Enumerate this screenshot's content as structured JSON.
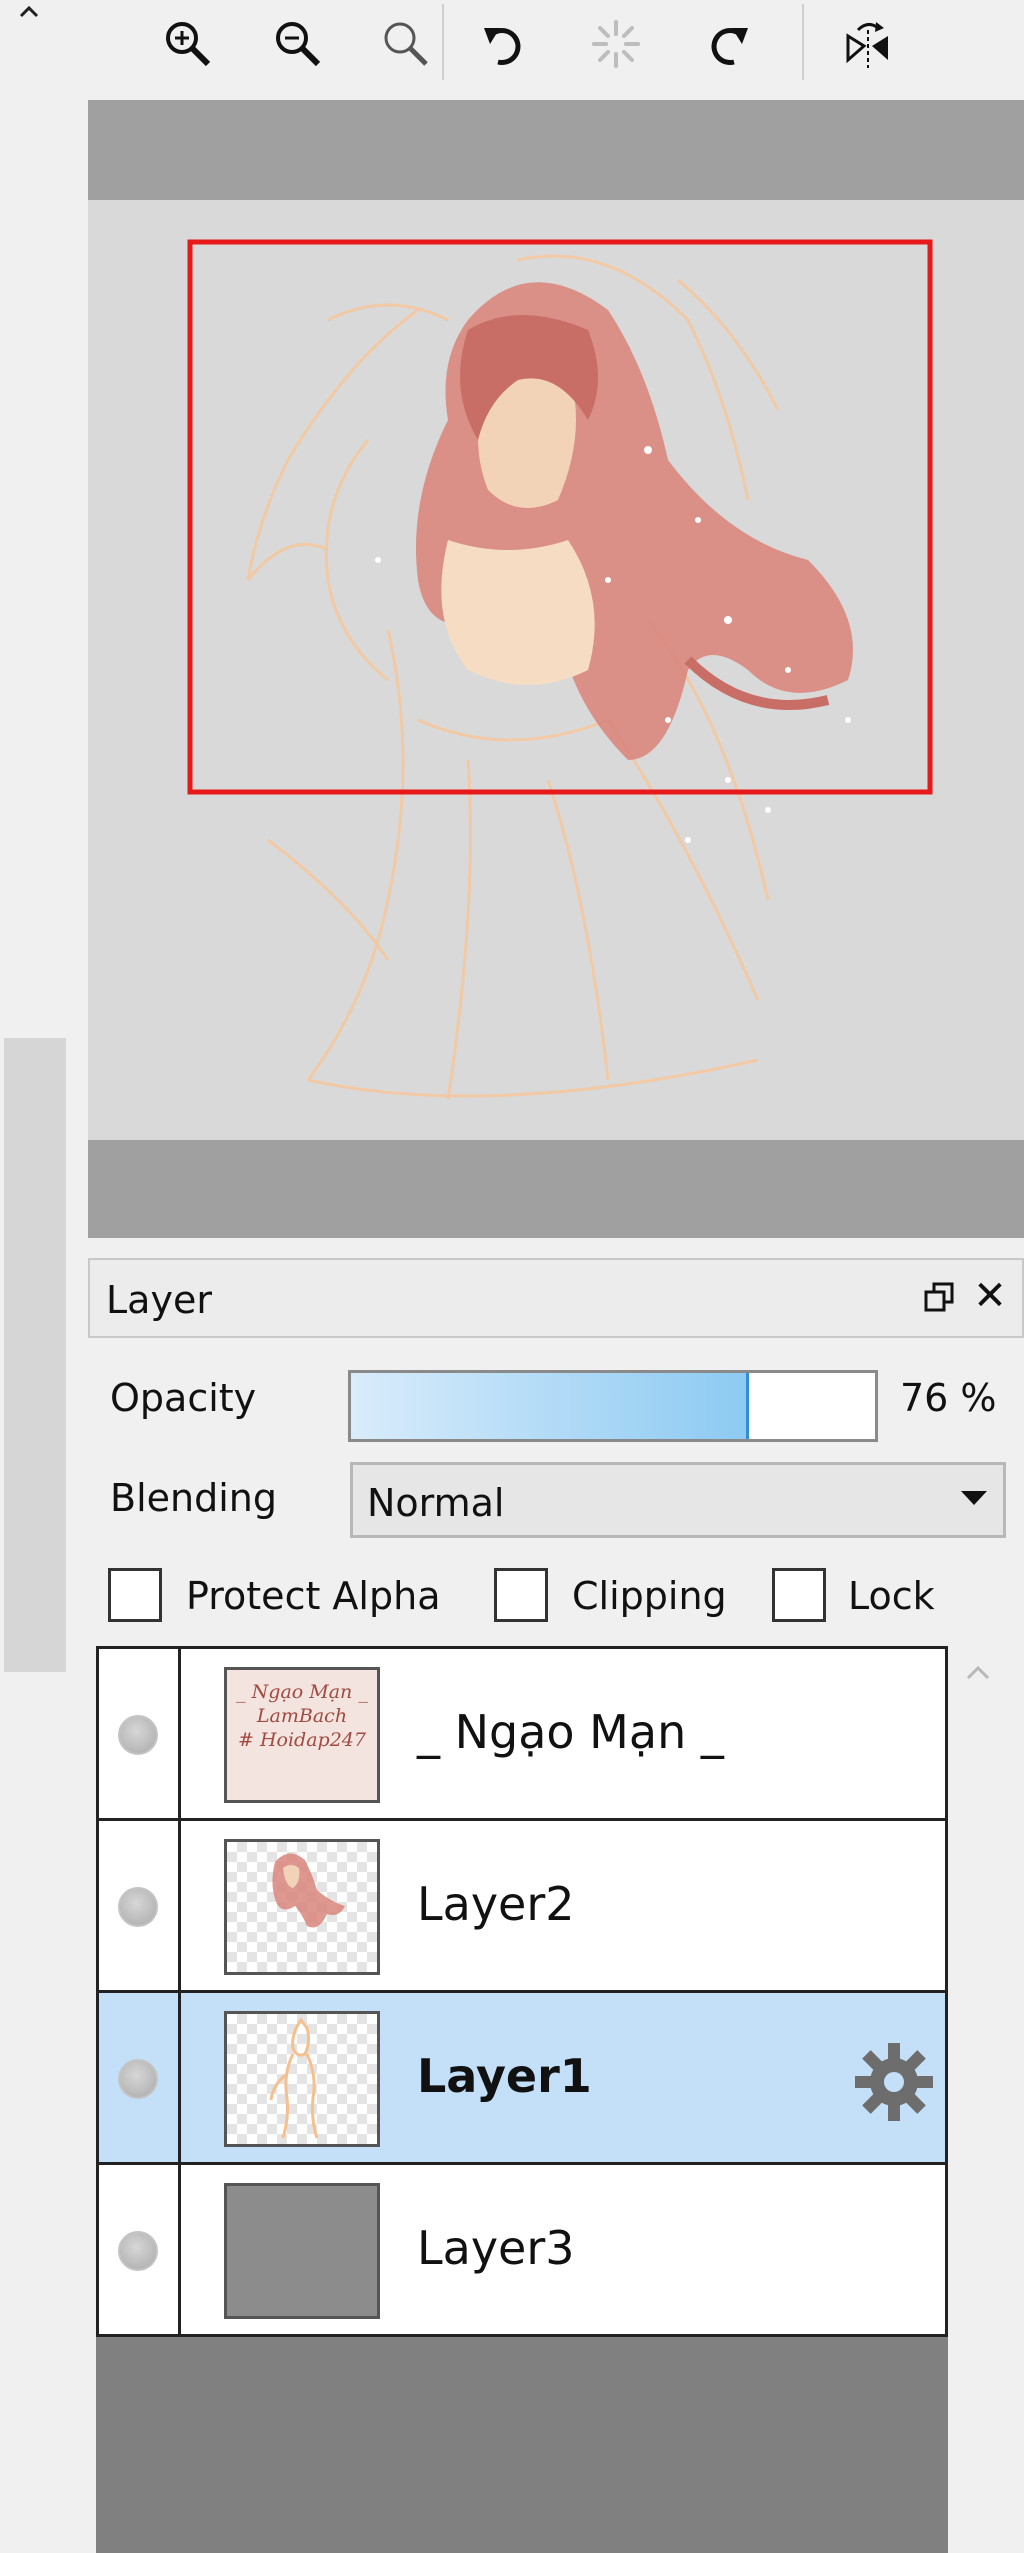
{
  "toolbar": {
    "buttons": [
      {
        "name": "zoom-in-icon",
        "label": "Zoom In"
      },
      {
        "name": "zoom-out-icon",
        "label": "Zoom Out"
      },
      {
        "name": "zoom-reset-icon",
        "label": "Actual Size"
      },
      {
        "name": "rotate-left-icon",
        "label": "Rotate Left"
      },
      {
        "name": "rotate-reset-icon",
        "label": "Reset Rotation"
      },
      {
        "name": "rotate-right-icon",
        "label": "Rotate Right"
      },
      {
        "name": "flip-horizontal-icon",
        "label": "Flip Horizontal"
      }
    ]
  },
  "navigator": {
    "viewport_color": "#e8191a"
  },
  "layer_panel": {
    "title": "Layer",
    "opacity_label": "Opacity",
    "opacity_value": "76 %",
    "opacity_level": 0.76,
    "blending_label": "Blending",
    "blending_value": "Normal",
    "protect_alpha_label": "Protect Alpha",
    "clipping_label": "Clipping",
    "lock_label": "Lock",
    "protect_alpha_checked": false,
    "clipping_checked": false,
    "lock_checked": false,
    "layers": [
      {
        "name": "_ Ngạo Mạn _",
        "thumb": "text",
        "thumb_text": [
          "_ Ngạo Mạn _",
          "LamBach",
          "# Hoidap247"
        ],
        "selected": false
      },
      {
        "name": "Layer2",
        "thumb": "painting",
        "selected": false
      },
      {
        "name": "Layer1",
        "thumb": "sketch",
        "selected": true
      },
      {
        "name": "Layer3",
        "thumb": "gray",
        "selected": false
      }
    ]
  },
  "colors": {
    "selected_row": "#c3e0f8",
    "accent_blue": "#2f8ed6"
  }
}
